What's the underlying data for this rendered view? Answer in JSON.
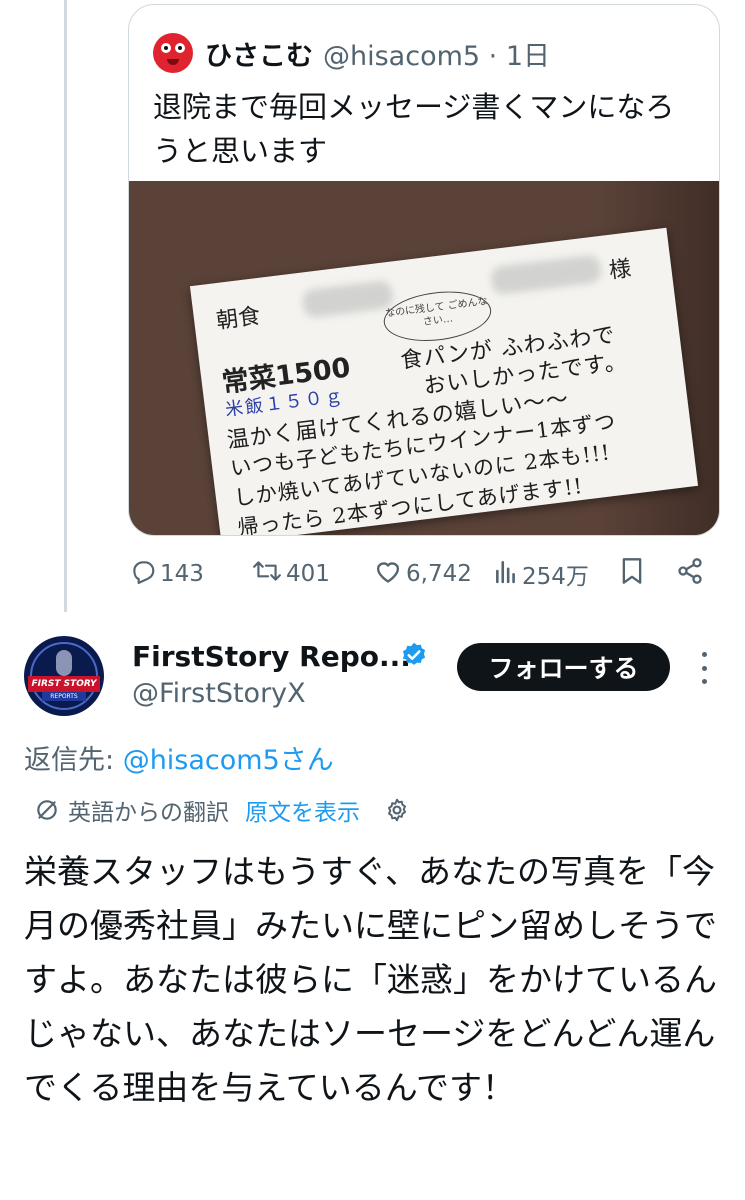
{
  "quoted_tweet": {
    "name": "ひさこむ",
    "handle_time": "@hisacom5 · 1日",
    "text": "退院まで毎回メッセージ書くマンになろうと思います",
    "photo_note": {
      "meal": "朝食",
      "suffix": "様",
      "diet": "常菜1500",
      "rice": "米飯１５０ｇ",
      "bubble": "なのに残して ごめんなさい…",
      "lines": [
        "食パンが ふわふわで",
        "おいしかったです。",
        "温かく届けてくれるの嬉しい〜〜",
        "いつも子どもたちにウインナー1本ずつ",
        "しか焼いてあげていないのに 2本も!!!",
        "帰ったら 2本ずつにしてあげます!!"
      ]
    },
    "actions": {
      "replies": "143",
      "reposts": "401",
      "likes": "6,742",
      "views": "254万"
    }
  },
  "reply": {
    "name": "FirstStory Repo...",
    "handle": "@FirstStoryX",
    "avatar_banner": "FIRST STORY",
    "avatar_sub": "REPORTS",
    "follow_label": "フォローする",
    "reply_to_prefix": "返信先: ",
    "reply_to_mention": "@hisacom5さん",
    "translated_from": "英語からの翻訳",
    "show_original": "原文を表示",
    "text": "栄養スタッフはもうすぐ、あなたの写真を「今月の優秀社員」みたいに壁にピン留めしそうですよ。あなたは彼らに「迷惑」をかけているんじゃない、あなたはソーセージをどんどん運んでくる理由を与えているんです！"
  },
  "colors": {
    "accent": "#1d9bf0",
    "muted": "#536471",
    "text": "#0f1419",
    "follow_bg": "#0f1419",
    "avatar_red": "#e0242f"
  },
  "icons": [
    "reply-icon",
    "repost-icon",
    "like-icon",
    "views-icon",
    "bookmark-icon",
    "share-icon",
    "verified-icon",
    "more-icon",
    "translate-icon",
    "gear-icon"
  ]
}
